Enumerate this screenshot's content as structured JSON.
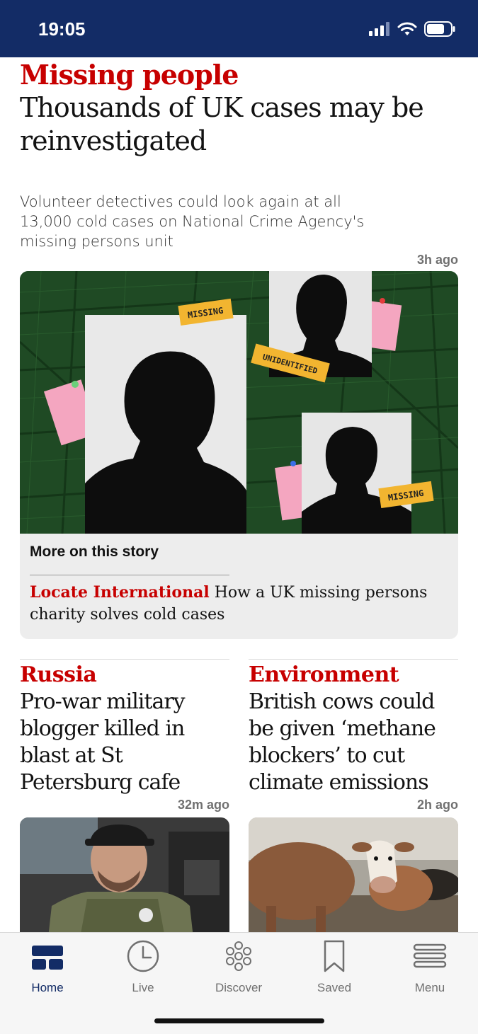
{
  "status_bar": {
    "time": "19:05"
  },
  "lead_story": {
    "kicker": "Missing people",
    "headline": "Thousands of UK cases may be reinvestigated",
    "standfirst": "Volunteer detectives could look again at all 13,000 cold cases on National Crime Agency's missing persons unit",
    "time": "3h ago",
    "image_labels": {
      "missing_1": "MISSING",
      "unidentified": "UNIDENTIFIED",
      "missing_2": "MISSING"
    },
    "more_title": "More on this story",
    "related": {
      "kicker": "Locate International",
      "headline": "How a UK missing persons charity solves cold cases"
    }
  },
  "cards": [
    {
      "kicker": "Russia",
      "headline": "Pro-war military blogger killed in blast at St Petersburg cafe",
      "time": "32m ago"
    },
    {
      "kicker": "Environment",
      "headline": "British cows could be given ‘methane blockers’ to cut climate emissions",
      "time": "2h ago"
    }
  ],
  "tabs": [
    {
      "label": "Home",
      "icon": "home-icon",
      "active": true
    },
    {
      "label": "Live",
      "icon": "clock-icon",
      "active": false
    },
    {
      "label": "Discover",
      "icon": "discover-icon",
      "active": false
    },
    {
      "label": "Saved",
      "icon": "bookmark-icon",
      "active": false
    },
    {
      "label": "Menu",
      "icon": "menu-icon",
      "active": false
    }
  ],
  "colors": {
    "navy": "#132c66",
    "kicker_red": "#c70000",
    "map_green": "#1f4a24",
    "tag_yellow": "#f2b530",
    "note_pink": "#f4a6c0"
  }
}
